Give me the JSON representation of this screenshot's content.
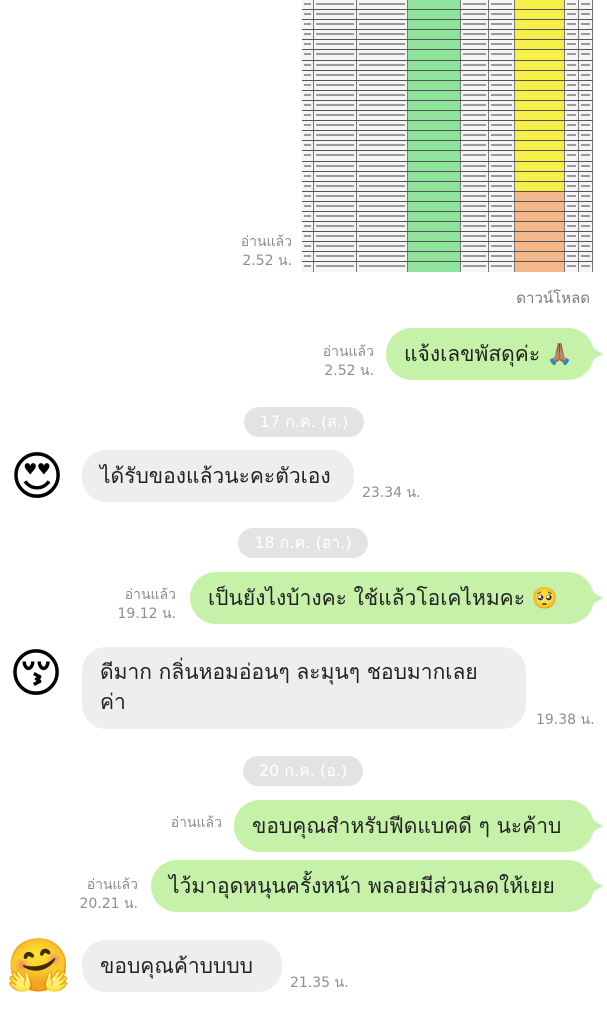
{
  "image_message": {
    "read_label": "อ่านแล้ว",
    "time": "2.52 น.",
    "download_label": "ดาวน์โหลด"
  },
  "messages": [
    {
      "id": "m1",
      "read_label": "อ่านแล้ว",
      "time": "2.52 น.",
      "text": "แจ้งเลขพัสดุค่ะ 🙏🏽"
    },
    {
      "id": "d1",
      "date": "17 ก.ค. (ส.)"
    },
    {
      "id": "m2",
      "text": "ได้รับของแล้วนะคะตัวเอง",
      "time": "23.34 น.",
      "avatar_emoji": "😍"
    },
    {
      "id": "d2",
      "date": "18 ก.ค. (อา.)"
    },
    {
      "id": "m3",
      "read_label": "อ่านแล้ว",
      "time": "19.12 น.",
      "text": "เป็นยังไงบ้างคะ ใช้แล้วโอเคไหมคะ 🥺"
    },
    {
      "id": "m4",
      "text_line1": "ดีมาก กลิ่นหอมอ่อนๆ ละมุนๆ ชอบมากเลย",
      "text_line2": "ค่า",
      "time": "19.38 น.",
      "avatar_emoji": "😚"
    },
    {
      "id": "d3",
      "date": "20 ก.ค. (อ.)"
    },
    {
      "id": "m5",
      "read_label": "อ่านแล้ว",
      "text": "ขอบคุณสำหรับฟีดแบคดี ๆ นะค้าบ"
    },
    {
      "id": "m6",
      "read_label": "อ่านแล้ว",
      "time": "20.21 น.",
      "text": "ไว้มาอุดหนุนครั้งหน้า พลอยมีส่วนลดให้เยย"
    },
    {
      "id": "m7",
      "text": "ขอบคุณค้าบบบบ",
      "time": "21.35 น.",
      "avatar_emoji": "🤗"
    }
  ],
  "colors": {
    "outgoing_bubble": "#c5f2a8",
    "incoming_bubble": "#eeeeee",
    "date_pill": "#e3e3e3",
    "meta_text": "#8e8e8e",
    "sheet_green": "#8fe39a",
    "sheet_yellow": "#f6ef4a",
    "sheet_orange": "#f4b88a"
  }
}
